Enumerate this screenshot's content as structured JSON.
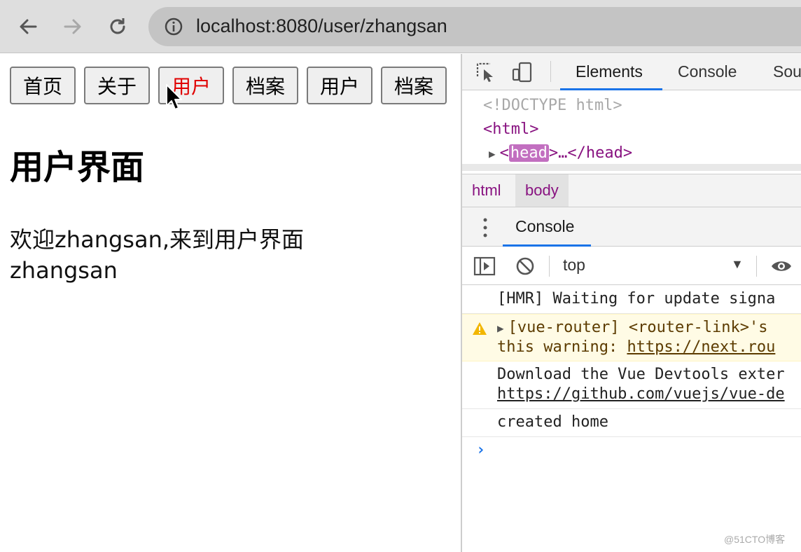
{
  "browser": {
    "url": "localhost:8080/user/zhangsan",
    "back_icon": "arrow-left-icon",
    "forward_icon": "arrow-right-icon",
    "reload_icon": "reload-icon",
    "info_icon": "info-circle-icon"
  },
  "page": {
    "buttons": [
      {
        "label": "首页"
      },
      {
        "label": "关于"
      },
      {
        "label": "用户",
        "active": true
      },
      {
        "label": "档案"
      },
      {
        "label": "用户"
      },
      {
        "label": "档案"
      }
    ],
    "title": "用户界面",
    "welcome": "欢迎zhangsan,来到用户界面",
    "username": "zhangsan"
  },
  "devtools": {
    "tabs": [
      "Elements",
      "Console",
      "Sou"
    ],
    "elements": {
      "doctype": "<!DOCTYPE html>",
      "html_open": "<html>",
      "head_open": "<",
      "head_tag": "head",
      "head_rest": ">…</head>"
    },
    "breadcrumbs": [
      "html",
      "body"
    ],
    "drawer_tab": "Console",
    "context": "top",
    "messages": {
      "hmr": "[HMR] Waiting for update signa",
      "warn_line1": "[vue-router] <router-link>'s",
      "warn_line2_prefix": "this warning: ",
      "warn_line2_link": "https://next.rou",
      "devtools_line1": "Download the Vue Devtools exter",
      "devtools_line2_link": "https://github.com/vuejs/vue-de",
      "created": "created home"
    },
    "prompt": "›"
  },
  "watermark": "@51CTO博客",
  "colors": {
    "active_button_text": "#e00000",
    "devtools_accent": "#1a73e8",
    "tag_color": "#881280",
    "warning_bg": "#fffbe5"
  }
}
